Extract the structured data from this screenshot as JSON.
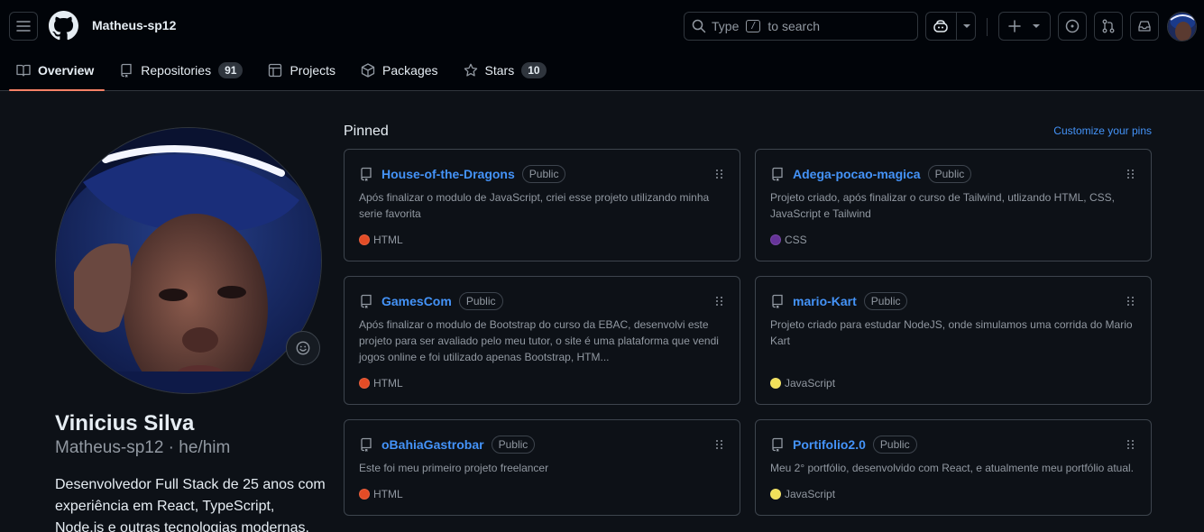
{
  "header": {
    "owner": "Matheus-sp12",
    "search": {
      "before": "Type",
      "key": "/",
      "after": "to search"
    }
  },
  "tabs": [
    {
      "label": "Overview",
      "icon": "book-icon"
    },
    {
      "label": "Repositories",
      "count": "91",
      "icon": "repo-icon"
    },
    {
      "label": "Projects",
      "icon": "table-icon"
    },
    {
      "label": "Packages",
      "icon": "package-icon"
    },
    {
      "label": "Stars",
      "count": "10",
      "icon": "star-icon"
    }
  ],
  "profile": {
    "name": "Vinicius Silva",
    "login_line": "Matheus-sp12 · he/him",
    "bio": "Desenvolvedor Full Stack de 25 anos com experiência em React, TypeScript, Node.js e outras tecnologias modernas."
  },
  "pinned": {
    "title": "Pinned",
    "customize": "Customize your pins",
    "repos": [
      {
        "name": "House-of-the-Dragons",
        "visibility": "Public",
        "description": "Após finalizar o modulo de JavaScript, criei esse projeto utilizando minha serie favorita",
        "language": "HTML",
        "lang_color": "#e34c26"
      },
      {
        "name": "Adega-pocao-magica",
        "visibility": "Public",
        "description": "Projeto criado, após finalizar o curso de Tailwind, utlizando HTML, CSS, JavaScript e Tailwind",
        "language": "CSS",
        "lang_color": "#663399"
      },
      {
        "name": "GamesCom",
        "visibility": "Public",
        "description": "Após finalizar o modulo de Bootstrap do curso da EBAC, desenvolvi este projeto para ser avaliado pelo meu tutor, o site é uma plataforma que vendi jogos online e foi utilizado apenas Bootstrap, HTM...",
        "language": "HTML",
        "lang_color": "#e34c26"
      },
      {
        "name": "mario-Kart",
        "visibility": "Public",
        "description": "Projeto criado para estudar NodeJS, onde simulamos uma corrida do Mario Kart",
        "language": "JavaScript",
        "lang_color": "#f1e05a"
      },
      {
        "name": "oBahiaGastrobar",
        "visibility": "Public",
        "description": "Este foi meu primeiro projeto freelancer",
        "language": "HTML",
        "lang_color": "#e34c26"
      },
      {
        "name": "Portifolio2.0",
        "visibility": "Public",
        "description": "Meu 2° portfólio, desenvolvido com React, e atualmente meu portfólio atual.",
        "language": "JavaScript",
        "lang_color": "#f1e05a"
      }
    ]
  },
  "colors": {
    "accent": "#4493f8",
    "tab_underline": "#f78166",
    "bg": "#0d1117",
    "header_bg": "#010409"
  }
}
